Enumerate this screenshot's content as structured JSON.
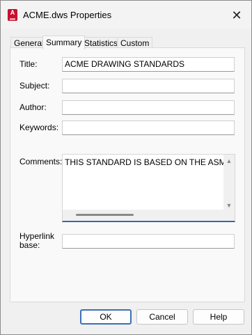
{
  "window": {
    "title": "ACME.dws Properties",
    "app_icon_label": "A"
  },
  "tabs": [
    {
      "label": "General",
      "active": false
    },
    {
      "label": "Summary",
      "active": true
    },
    {
      "label": "Statistics",
      "active": false
    },
    {
      "label": "Custom",
      "active": false
    }
  ],
  "form": {
    "title_label": "Title:",
    "title_value": "ACME DRAWING STANDARDS",
    "subject_label": "Subject:",
    "subject_value": "",
    "author_label": "Author:",
    "author_value": "",
    "keywords_label": "Keywords:",
    "keywords_value": "",
    "comments_label": "Comments:",
    "comments_value": "THIS STANDARD IS BASED ON THE ASME S",
    "hyperlink_label_line1": "Hyperlink",
    "hyperlink_label_line2": "base:",
    "hyperlink_value": ""
  },
  "buttons": {
    "ok": "OK",
    "cancel": "Cancel",
    "help": "Help"
  },
  "colors": {
    "accent": "#3d6fb5",
    "app_icon": "#c8102e"
  }
}
